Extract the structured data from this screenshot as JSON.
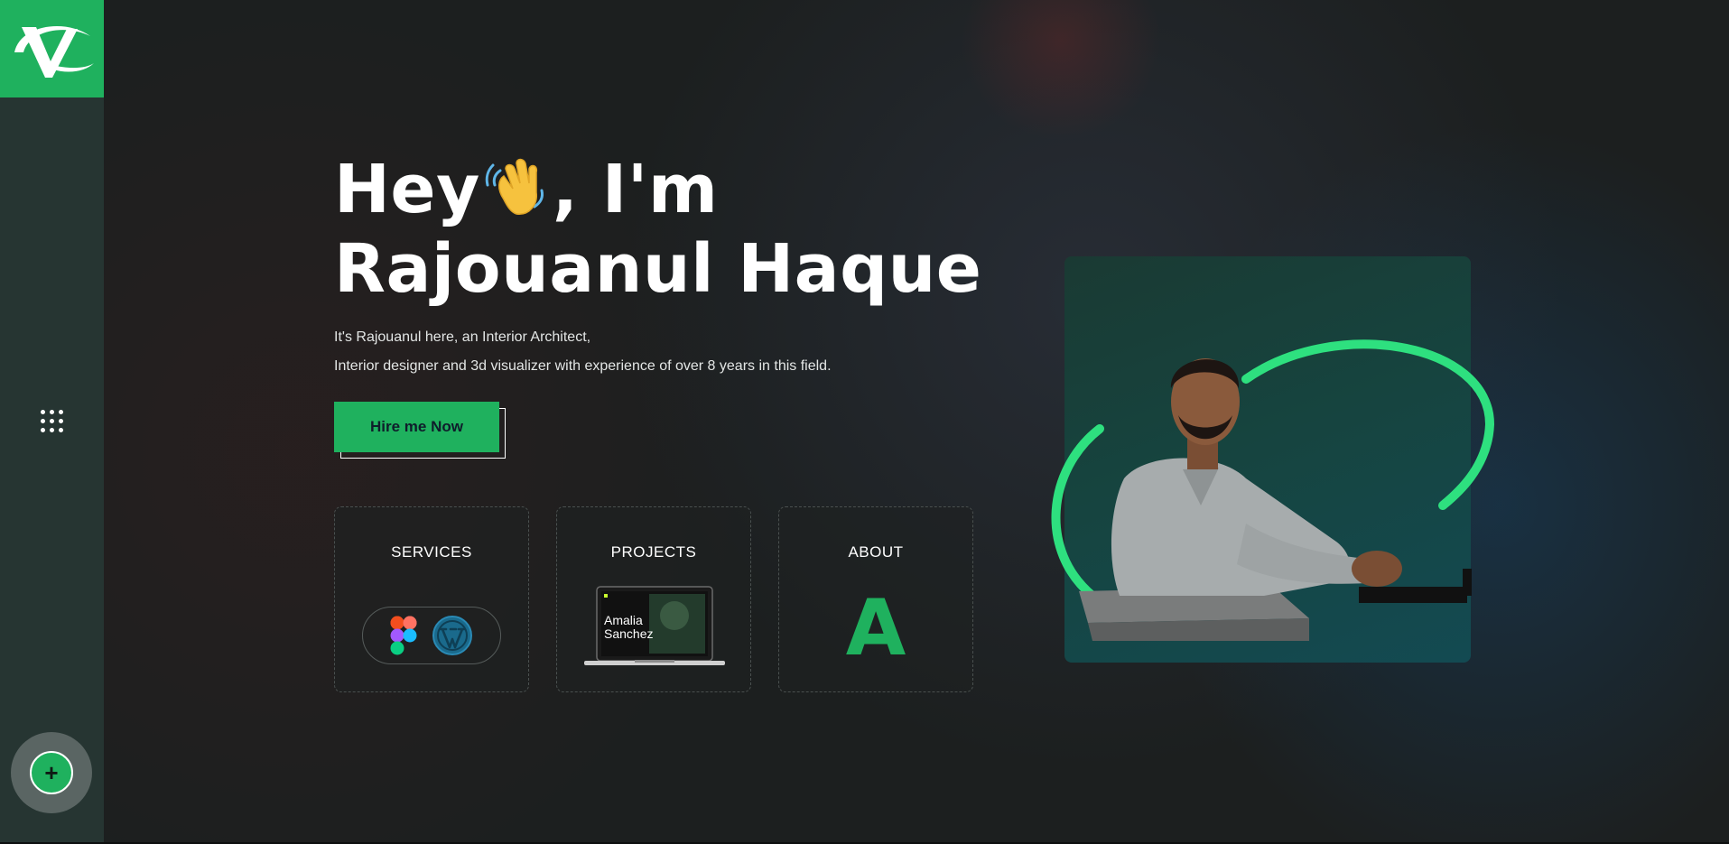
{
  "brand": {
    "logo_letter": "V",
    "accent": "#1fb15e"
  },
  "sidebar": {
    "menu_icon": "grid-dots-icon",
    "add_icon": "plus-icon",
    "add_label": "+"
  },
  "hero": {
    "line1_before": "Hey",
    "line1_emoji": "waving-hand-icon",
    "line1_after": ", I'm",
    "line2": "Rajouanul Haque",
    "intro_1": "It's Rajouanul here, an Interior Architect,",
    "intro_2": "Interior designer and 3d visualizer with experience of over 8 years in this field.",
    "cta_label": "Hire me Now"
  },
  "cards": [
    {
      "title": "SERVICES",
      "icons": [
        "figma-icon",
        "wordpress-icon"
      ]
    },
    {
      "title": "PROJECTS",
      "preview_text": "Amalia Sanchez",
      "preview_line1": "Amalia",
      "preview_line2": "Sanchez"
    },
    {
      "title": "ABOUT",
      "letter": "A"
    }
  ],
  "portrait": {
    "subject": "portrait-photo"
  }
}
